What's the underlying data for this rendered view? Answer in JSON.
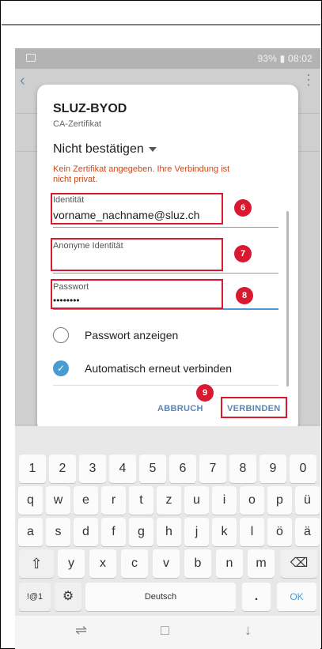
{
  "status_bar": {
    "right_text": "93% ▮ 08:02"
  },
  "dialog": {
    "title": "SLUZ-BYOD",
    "cert_label": "CA-Zertifikat",
    "cert_value": "Nicht bestätigen",
    "warning": "Kein Zertifikat angegeben. Ihre Verbindung ist nicht privat.",
    "identity_label": "Identität",
    "identity_value": "vorname_nachname@sluz.ch",
    "anon_label": "Anonyme Identität",
    "anon_value": "",
    "password_label": "Passwort",
    "password_value": "••••••••",
    "show_password_label": "Passwort anzeigen",
    "auto_reconnect_label": "Automatisch erneut verbinden",
    "cancel_label": "ABBRUCH",
    "connect_label": "VERBINDEN"
  },
  "annotations": {
    "identity": "6",
    "anon": "7",
    "password": "8",
    "connect": "9"
  },
  "keyboard": {
    "row1": [
      "1",
      "2",
      "3",
      "4",
      "5",
      "6",
      "7",
      "8",
      "9",
      "0"
    ],
    "row2": [
      "q",
      "w",
      "e",
      "r",
      "t",
      "z",
      "u",
      "i",
      "o",
      "p",
      "ü"
    ],
    "row3": [
      "a",
      "s",
      "d",
      "f",
      "g",
      "h",
      "j",
      "k",
      "l",
      "ö",
      "ä"
    ],
    "row4": [
      "y",
      "x",
      "c",
      "v",
      "b",
      "n",
      "m"
    ],
    "sym_label": "!@1",
    "space_label": "Deutsch",
    "period_label": ".",
    "ok_label": "OK",
    "shift_icon": "⇧",
    "backspace_icon": "⌫",
    "settings_icon": "⚙"
  },
  "navbar": {
    "recent_icon": "⇌",
    "home_icon": "□",
    "back_icon": "↓"
  },
  "colors": {
    "accent": "#4a9ad4",
    "warning": "#c84b1e",
    "annotation": "#d8192f",
    "button": "#5a86b5"
  }
}
